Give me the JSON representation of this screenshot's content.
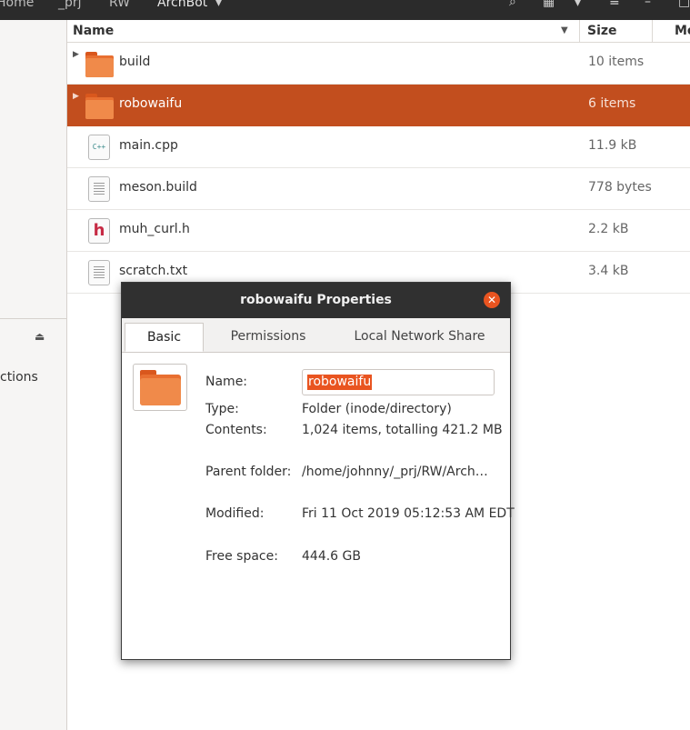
{
  "header": {
    "breadcrumbs": [
      "Home",
      "_prj",
      "RW",
      "ArchBot"
    ],
    "icons": [
      "search-icon",
      "view-grid-icon",
      "chevron-down-icon",
      "menu-icon",
      "maximize-icon"
    ]
  },
  "sidebar": {
    "partial_label": "ctions",
    "eject_icon": "eject-icon"
  },
  "list": {
    "columns": {
      "name": "Name",
      "size": "Size",
      "modified_partial": "Mo"
    },
    "rows": [
      {
        "name": "build",
        "size": "10 items",
        "icon": "folder-icon",
        "selected": false
      },
      {
        "name": "robowaifu",
        "size": "6 items",
        "icon": "folder-icon",
        "selected": true
      },
      {
        "name": "main.cpp",
        "size": "11.9 kB",
        "icon": "cpp-file-icon",
        "selected": false,
        "icon_text": "C++"
      },
      {
        "name": "meson.build",
        "size": "778 bytes",
        "icon": "text-file-icon",
        "selected": false
      },
      {
        "name": "muh_curl.h",
        "size": "2.2 kB",
        "icon": "header-file-icon",
        "selected": false,
        "icon_text": "h"
      },
      {
        "name": "scratch.txt",
        "size": "3.4 kB",
        "icon": "text-file-icon",
        "selected": false
      }
    ]
  },
  "dialog": {
    "title": "robowaifu Properties",
    "tabs": [
      "Basic",
      "Permissions",
      "Local Network Share"
    ],
    "active_tab": "Basic",
    "fields": {
      "name_label": "Name:",
      "name_value": "robowaifu",
      "type_label": "Type:",
      "type_value": "Folder (inode/directory)",
      "contents_label": "Contents:",
      "contents_value": "1,024 items, totalling 421.2 MB",
      "parent_label": "Parent folder:",
      "parent_value": "/home/johnny/_prj/RW/Arch…",
      "modified_label": "Modified:",
      "modified_value": "Fri 11 Oct 2019 05:12:53 AM EDT",
      "free_label": "Free space:",
      "free_value": "444.6 GB"
    }
  },
  "colors": {
    "accent": "#e95420",
    "selection": "#c24e1e",
    "headerbar": "#2b2b2b",
    "dialog_titlebar": "#303030"
  }
}
